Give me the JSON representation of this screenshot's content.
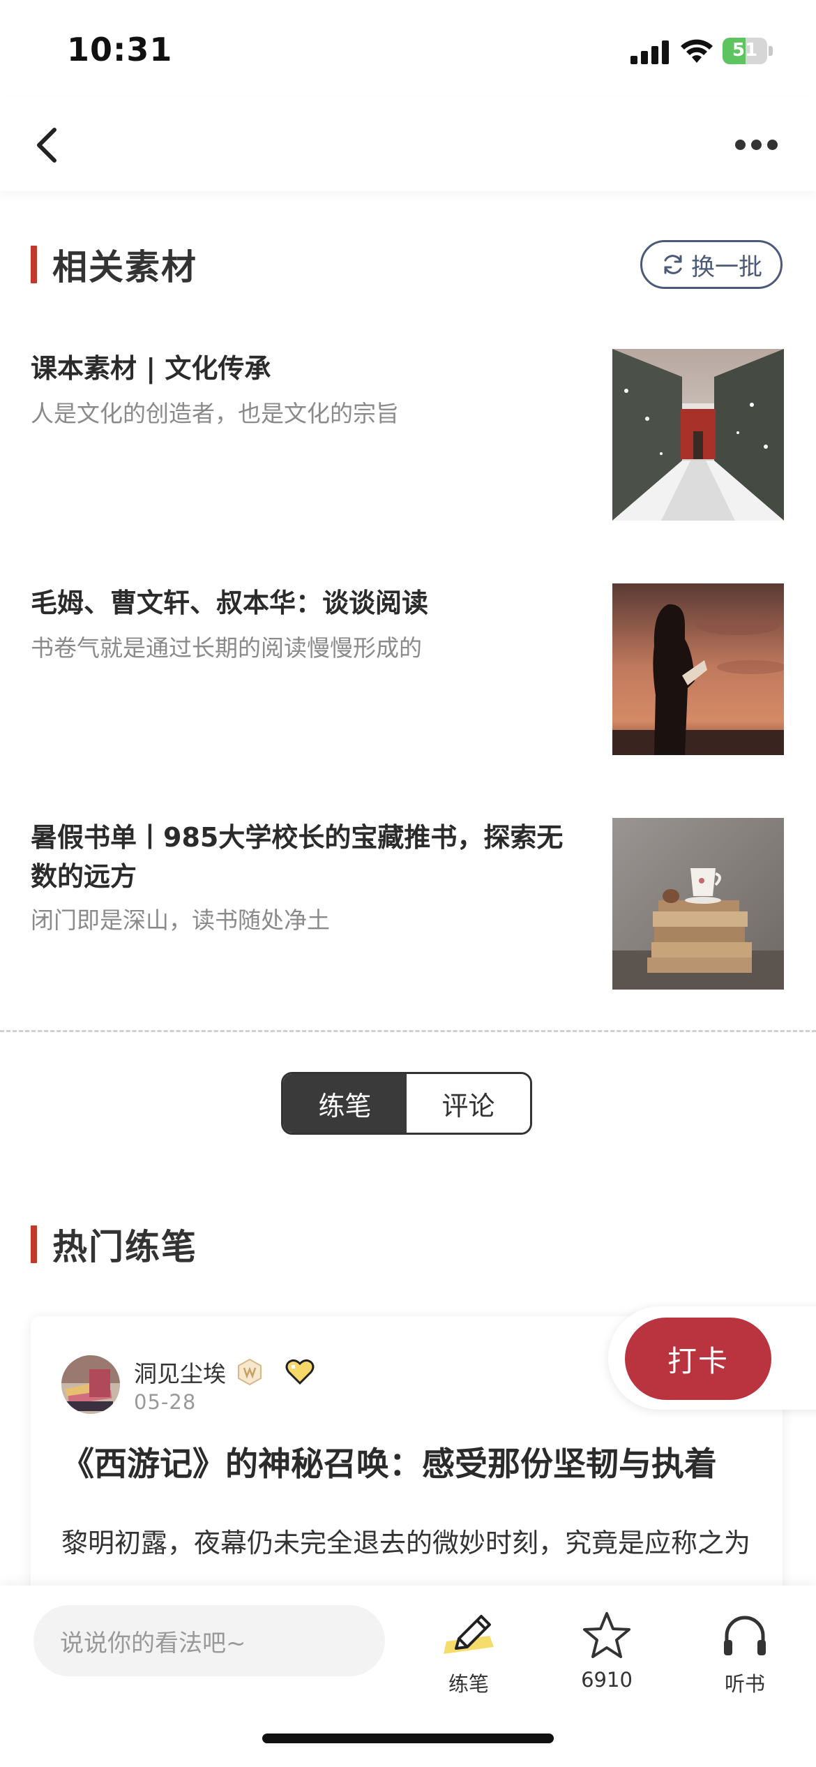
{
  "status_bar": {
    "time": "10:31",
    "battery_percent": "51",
    "battery_level": 0.51
  },
  "nav": {
    "back_icon": "chevron-left-icon",
    "more_icon": "more-dots-icon"
  },
  "related": {
    "title": "相关素材",
    "refresh_label": "换一批",
    "items": [
      {
        "title": "课本素材 | 文化传承",
        "desc": "人是文化的创造者，也是文化的宗旨"
      },
      {
        "title": "毛姆、曹文轩、叔本华：谈谈阅读",
        "desc": "书卷气就是通过长期的阅读慢慢形成的"
      },
      {
        "title": "暑假书单丨985大学校长的宝藏推书，探索无数的远方",
        "desc": "闭门即是深山，读书随处净土"
      }
    ]
  },
  "toggle": {
    "practice_label": "练笔",
    "comments_label": "评论",
    "active": "练笔"
  },
  "hot": {
    "title": "热门练笔",
    "post": {
      "author": "洞见尘埃",
      "date": "05-28",
      "title": "《西游记》的神秘召唤：感受那份坚韧与执着",
      "body": "黎明初露，夜幕仍未完全退去的微妙时刻，究竟是应称之为"
    }
  },
  "checkin_label": "打卡",
  "bottom_bar": {
    "input_placeholder": "说说你的看法吧~",
    "practice_label": "练笔",
    "star_count": "6910",
    "listen_label": "听书"
  },
  "colors": {
    "accent_red": "#c0392b",
    "checkin_red": "#b9343f",
    "outline_blue": "#4a5a78"
  }
}
